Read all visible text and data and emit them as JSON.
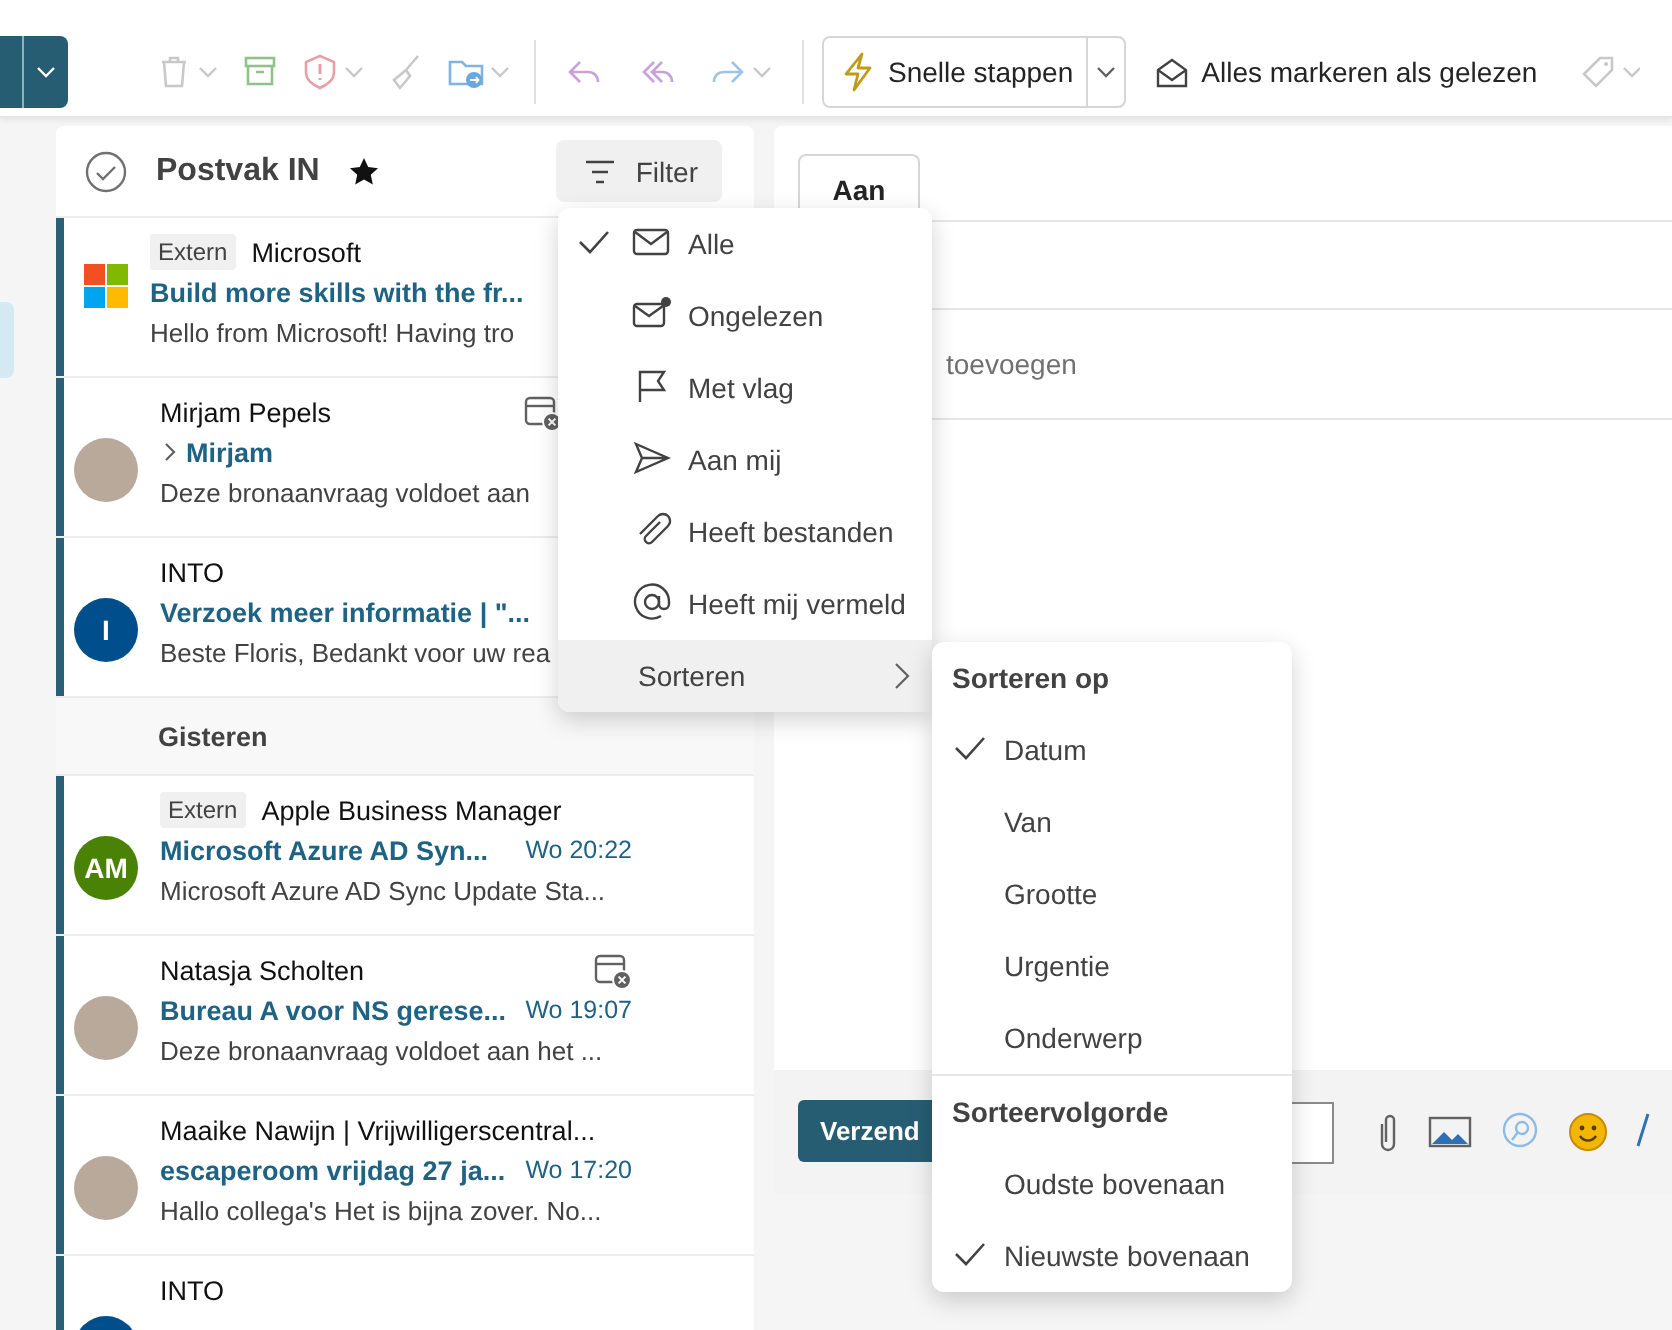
{
  "toolbar": {
    "quick_steps": "Snelle stappen",
    "mark_all_read": "Alles markeren als gelezen"
  },
  "mail_list": {
    "title": "Postvak IN",
    "filter_button": "Filter",
    "items": [
      {
        "kind": "message",
        "avatar": {
          "kind": "logo"
        },
        "tag": "Extern",
        "sender": "Microsoft",
        "subject": "Build more skills with the fr...",
        "preview": "Hello from Microsoft! Having tro",
        "unread": true
      },
      {
        "kind": "message",
        "avatar": {
          "kind": "photo"
        },
        "sender": "Mirjam Pepels",
        "thread": true,
        "calendar": true,
        "subject": "Mirjam",
        "preview": "Deze bronaanvraag voldoet aan",
        "unread": true
      },
      {
        "kind": "message",
        "avatar": {
          "kind": "initials",
          "initials": "I",
          "color": "#004e8c"
        },
        "sender": "INTO",
        "subject": "Verzoek meer informatie | \"...",
        "preview": "Beste Floris, Bedankt voor uw rea",
        "unread": true
      },
      {
        "kind": "group",
        "label": "Gisteren"
      },
      {
        "kind": "message",
        "avatar": {
          "kind": "initials",
          "initials": "AM",
          "color": "#498205"
        },
        "tag": "Extern",
        "sender": "Apple Business Manager",
        "subject": "Microsoft Azure AD Syn...",
        "time": "Wo 20:22",
        "preview": "Microsoft Azure AD Sync Update Sta...",
        "unread": true
      },
      {
        "kind": "message",
        "avatar": {
          "kind": "photo"
        },
        "sender": "Natasja Scholten",
        "calendar": true,
        "subject": "Bureau A voor NS gerese...",
        "time": "Wo 19:07",
        "preview": "Deze bronaanvraag voldoet aan het ...",
        "unread": true
      },
      {
        "kind": "message",
        "avatar": {
          "kind": "photo"
        },
        "sender": "Maaike Nawijn | Vrijwilligerscentral...",
        "subject": "escaperoom vrijdag 27 ja...",
        "time": "Wo 17:20",
        "preview": "Hallo collega's Het is bijna zover. No...",
        "unread": true
      },
      {
        "kind": "message",
        "avatar": {
          "kind": "initials",
          "color": "#004e8c"
        },
        "sender": "INTO",
        "unread": true
      }
    ]
  },
  "filter_menu": {
    "items": [
      {
        "kind": "filter",
        "label": "Alle",
        "selected": true
      },
      {
        "kind": "filter",
        "label": "Ongelezen",
        "selected": false
      },
      {
        "kind": "filter",
        "label": "Met vlag",
        "selected": false
      },
      {
        "kind": "filter",
        "label": "Aan mij",
        "selected": false
      },
      {
        "kind": "filter",
        "label": "Heeft bestanden",
        "selected": false
      },
      {
        "kind": "filter",
        "label": "Heeft mij vermeld",
        "selected": false
      },
      {
        "kind": "submenu",
        "label": "Sorteren",
        "expanded": true
      }
    ]
  },
  "sort_menu": {
    "sections": [
      {
        "heading": "Sorteren op",
        "options": [
          {
            "label": "Datum",
            "selected": true
          },
          {
            "label": "Van",
            "selected": false
          },
          {
            "label": "Grootte",
            "selected": false
          },
          {
            "label": "Urgentie",
            "selected": false
          },
          {
            "label": "Onderwerp",
            "selected": false
          }
        ]
      },
      {
        "heading": "Sorteervolgorde",
        "options": [
          {
            "label": "Oudste bovenaan",
            "selected": false
          },
          {
            "label": "Nieuwste bovenaan",
            "selected": true
          }
        ]
      }
    ]
  },
  "compose": {
    "to_button": "Aan",
    "recipient_placeholder": "toevoegen",
    "send_button": "Verzend"
  }
}
